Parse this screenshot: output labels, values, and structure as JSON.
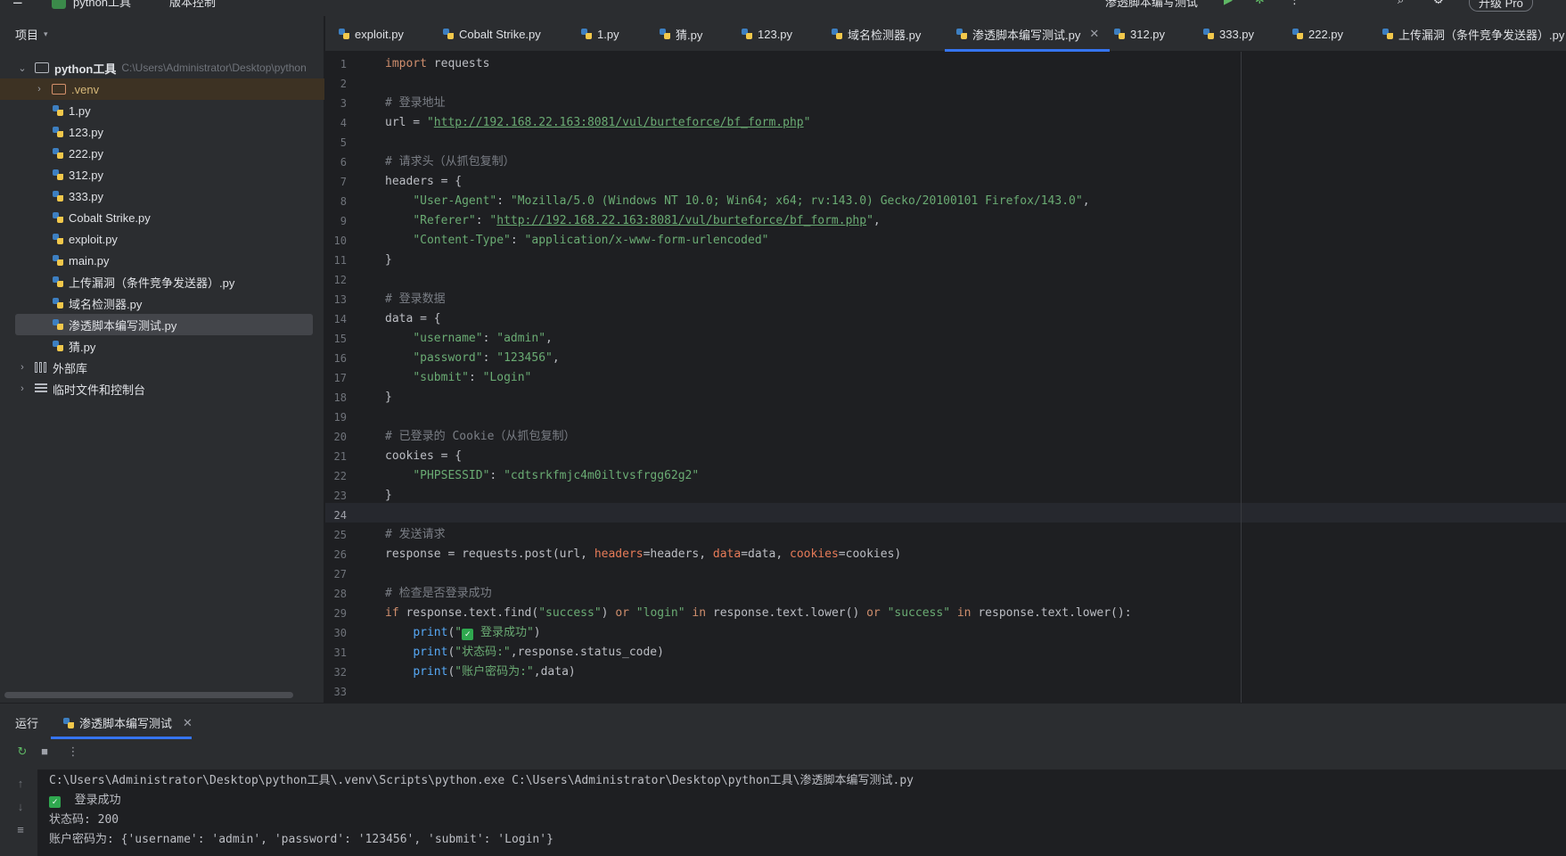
{
  "topbar": {
    "project_name": "python工具",
    "vcs": "版本控制",
    "run_config": "渗透脚本编写测试",
    "upgrade": "升级 Pro"
  },
  "project_panel": {
    "title": "项目",
    "root": {
      "name": "python工具",
      "path": "C:\\Users\\Administrator\\Desktop\\python"
    },
    "venv": ".venv",
    "files": [
      "1.py",
      "123.py",
      "222.py",
      "312.py",
      "333.py",
      "Cobalt Strike.py",
      "exploit.py",
      "main.py",
      "上传漏洞（条件竞争发送器）.py",
      "域名检测器.py",
      "渗透脚本编写测试.py",
      "猜.py"
    ],
    "selected": "渗透脚本编写测试.py",
    "external_libs": "外部库",
    "scratches": "临时文件和控制台"
  },
  "tabs": [
    "exploit.py",
    "Cobalt Strike.py",
    "1.py",
    "猜.py",
    "123.py",
    "域名检测器.py",
    "渗透脚本编写测试.py",
    "312.py",
    "333.py",
    "222.py",
    "上传漏洞（条件竞争发送器）.py"
  ],
  "active_tab": "渗透脚本编写测试.py",
  "editor": {
    "current_line": 24,
    "line_count": 33,
    "code": {
      "l1_kw": "import",
      "l1_rest": " requests",
      "l3": "# 登录地址",
      "l4_a": "url = ",
      "l4_url": "http://192.168.22.163:8081/vul/burteforce/bf_form.php",
      "l6": "# 请求头（从抓包复制）",
      "l7": "headers = {",
      "l8_k": "\"User-Agent\"",
      "l8_v": "\"Mozilla/5.0 (Windows NT 10.0; Win64; x64; rv:143.0) Gecko/20100101 Firefox/143.0\"",
      "l9_k": "\"Referer\"",
      "l9_v": "http://192.168.22.163:8081/vul/burteforce/bf_form.php",
      "l10_k": "\"Content-Type\"",
      "l10_v": "\"application/x-www-form-urlencoded\"",
      "l11": "}",
      "l13": "# 登录数据",
      "l14": "data = {",
      "l15_k": "\"username\"",
      "l15_v": "\"admin\"",
      "l16_k": "\"password\"",
      "l16_v": "\"123456\"",
      "l17_k": "\"submit\"",
      "l17_v": "\"Login\"",
      "l18": "}",
      "l20": "# 已登录的 Cookie（从抓包复制）",
      "l21": "cookies = {",
      "l22_k": "\"PHPSESSID\"",
      "l22_v": "\"cdtsrkfmjc4m0iltvsfrgg62g2\"",
      "l23": "}",
      "l25": "# 发送请求",
      "l26_a": "response = requests.post(url, ",
      "l26_p1": "headers",
      "l26_b": "=headers, ",
      "l26_p2": "data",
      "l26_c": "=data, ",
      "l26_p3": "cookies",
      "l26_d": "=cookies)",
      "l28": "# 检查是否登录成功",
      "l29_if": "if",
      "l29_a": " response.text.find(",
      "l29_s1": "\"success\"",
      "l29_b": ") ",
      "l29_or1": "or",
      "l29_s2": " \"login\"",
      "l29_in1": " in",
      "l29_c": " response.text.lower() ",
      "l29_or2": "or",
      "l29_s3": " \"success\"",
      "l29_in2": " in",
      "l29_d": " response.text.lower():",
      "l30_s": "登录成功",
      "l31_s": "\"状态码:\"",
      "l31_rest": ",response.status_code)",
      "l32_s": "\"账户密码为:\"",
      "l32_rest": ",data)"
    }
  },
  "run_panel": {
    "title": "运行",
    "tab": "渗透脚本编写测试",
    "output": [
      "C:\\Users\\Administrator\\Desktop\\python工具\\.venv\\Scripts\\python.exe C:\\Users\\Administrator\\Desktop\\python工具\\渗透脚本编写测试.py",
      "登录成功",
      "状态码: 200",
      "账户密码为: {'username': 'admin', 'password': '123456', 'submit': 'Login'}"
    ]
  }
}
